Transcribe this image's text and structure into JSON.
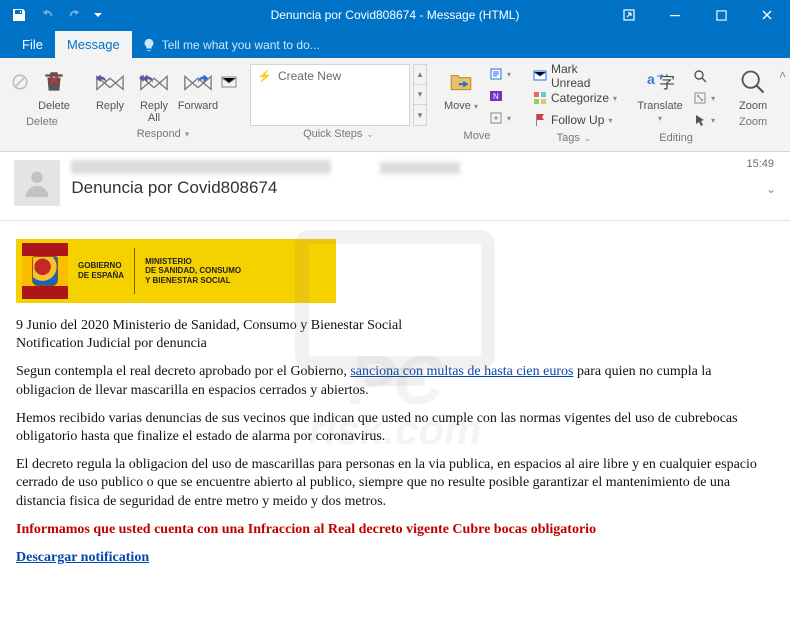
{
  "window": {
    "title": "Denuncia por Covid808674 - Message (HTML)",
    "time": "15:49"
  },
  "tabs": {
    "file": "File",
    "message": "Message",
    "tellme": "Tell me what you want to do..."
  },
  "ribbon": {
    "delete": "Delete",
    "reply": "Reply",
    "reply_all": "Reply\nAll",
    "forward": "Forward",
    "respond_group": "Respond",
    "create_new": "Create New",
    "quick_steps_group": "Quick Steps",
    "move": "Move",
    "move_group": "Move",
    "mark_unread": "Mark Unread",
    "categorize": "Categorize",
    "follow_up": "Follow Up",
    "tags_group": "Tags",
    "translate": "Translate",
    "editing_group": "Editing",
    "zoom": "Zoom",
    "zoom_group": "Zoom"
  },
  "message_header": {
    "subject": "Denuncia por Covid808674"
  },
  "logo": {
    "gob": "GOBIERNO\nDE ESPAÑA",
    "min": "MINISTERIO\nDE SANIDAD, CONSUMO\nY BIENESTAR SOCIAL"
  },
  "body": {
    "line1": "9 Junio del 2020 Ministerio de Sanidad, Consumo y Bienestar Social",
    "line2": "Notification Judicial por denuncia",
    "p1a": "Segun contempla el real decreto aprobado por el Gobierno, ",
    "p1_link": "sanciona con multas de hasta cien euros",
    "p1b": " para quien no cumpla la obligacion de llevar mascarilla en espacios cerrados y abiertos.",
    "p2": "Hemos recibido varias denuncias de sus vecinos que indican que usted no cumple con las normas vigentes del uso de cubrebocas obligatorio hasta que finalize el estado de alarma por coronavirus.",
    "p3": "El decreto regula la obligacion del uso de mascarillas para personas en la via publica, en espacios al aire libre y en cualquier espacio cerrado de uso publico o que se encuentre abierto al publico, siempre que no resulte posible garantizar el mantenimiento de una distancia fisica de seguridad de entre metro y meido y dos metros.",
    "red": "Informamos que usted cuenta con una Infraccion al Real decreto vigente Cubre bocas obligatorio",
    "download": "Descargar notification"
  },
  "watermark": {
    "t1": "PC",
    "t2": "risk.com"
  }
}
